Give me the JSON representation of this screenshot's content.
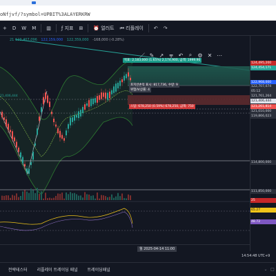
{
  "browser": {
    "url": "oNfjvf/?symbol=UPBIT%3ALAYERKRW"
  },
  "toolbar": {
    "add_symbol": "+",
    "timeframes": [
      "D",
      "W",
      "M"
    ],
    "indicators_label": "지표",
    "alert_label": "얼러트",
    "replay_label": "리플레이",
    "undo_label": "↶",
    "redo_label": "↷"
  },
  "legend": {
    "bb_values": "21 123,407,096",
    "ma_value": "122,159,000",
    "price_value": "122,359,000",
    "change_value": "-168,000 (-0.28%)"
  },
  "drawing_tools": [
    "／",
    "✎",
    "↗",
    "╤",
    "↶",
    "⌕",
    "⚙",
    "✕",
    "⋯"
  ],
  "position": {
    "target_text": "목표: 2,183,000 (1.65%) 2,174,900, 금액: 1999.90",
    "profit_text": "포지션손익 표시: 817,736, 수량: 9",
    "profit_text2": "위험/보상률: 4",
    "stop_text": "스탑: 678,250 (0.59%) 678,250, 금액: 750"
  },
  "left_label": "21,406,444",
  "price_scale": {
    "labels": [
      {
        "text": "124,495,200",
        "style": "red"
      },
      {
        "text": "124,454,171",
        "style": "green"
      },
      {
        "text": "122,968,000",
        "style": "navy"
      },
      {
        "text": "122,707,074",
        "style": "dark"
      },
      {
        "text": "05:12",
        "style": "dark"
      },
      {
        "text": "121,761,264",
        "style": "dark"
      },
      {
        "text": "121,406,444",
        "style": "white"
      },
      {
        "text": "121,261,814",
        "style": "redlt"
      },
      {
        "text": "121,010,000",
        "style": "dark"
      },
      {
        "text": "119,866,023",
        "style": "dark"
      },
      {
        "text": "114,800,000",
        "style": "dark"
      },
      {
        "text": "111,850,000",
        "style": "dark"
      },
      {
        "text": "25",
        "style": "red"
      },
      {
        "text": "65.27",
        "style": "yellow"
      },
      {
        "text": "48.72",
        "style": "purple"
      }
    ]
  },
  "time_axis": {
    "cursor_time": "월 2025-04-14  11:00"
  },
  "status": {
    "clock": "14:54:48 UTC+9"
  },
  "bottom_tabs": [
    "전략테스터",
    "리플레이 트레이딩 패널",
    "트레이딩패널"
  ],
  "colors": {
    "background": "#131722",
    "up": "#26a69a",
    "down": "#ef5350",
    "bb_band": "#2a6b3a",
    "trendline": "#26a69a"
  }
}
